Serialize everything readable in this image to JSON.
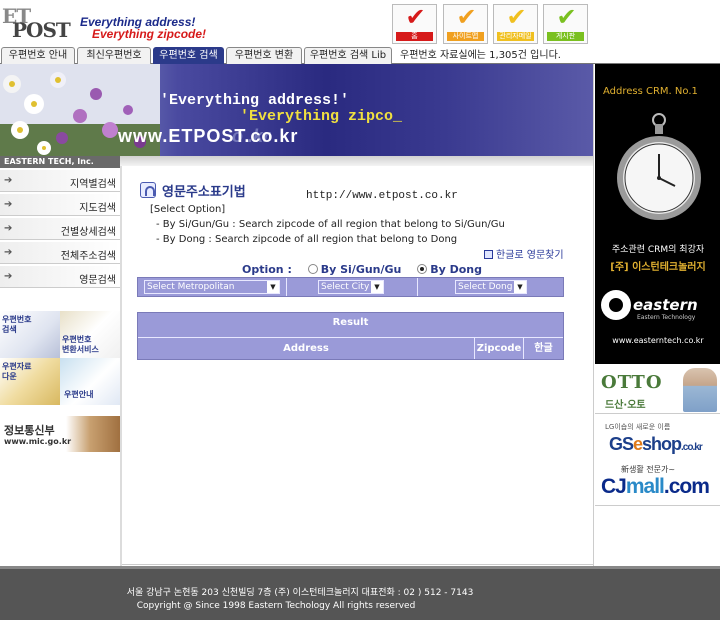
{
  "header": {
    "logo_et": "ET",
    "logo_post": "POST",
    "slogan_line1": "Everything address!",
    "slogan_line2": "Everything zipcode!",
    "checks": [
      {
        "label": "홈",
        "color": "#d61a1a",
        "mark": "✔"
      },
      {
        "label": "사이트맵",
        "color": "#f0a020",
        "mark": "✔"
      },
      {
        "label": "관리자메일",
        "color": "#f0c020",
        "mark": "✔"
      },
      {
        "label": "게시판",
        "color": "#7ac020",
        "mark": "✔"
      }
    ]
  },
  "nav": {
    "tabs": [
      "우편번호 안내",
      "최신우편번호",
      "우편번호 검색",
      "우편번호 변환",
      "우편번호 검색 Lib"
    ],
    "active_tab": "우편번호 검색",
    "info": "우편번호 자료실에는 1,305건 입니다."
  },
  "hero": {
    "line1": "'Everything address!'",
    "line2": "'Everything zipco_",
    "url": "www.ETPOST.co.kr",
    "url_shadow": "o .kr"
  },
  "sidebar": {
    "heading": "EASTERN TECH, Inc.",
    "items": [
      "지역별검색",
      "지도검색",
      "건별상세검색",
      "전체주소검색",
      "영문검색"
    ],
    "banners": {
      "a": "우편번호\n검색",
      "b": "우편번호\n변환서비스",
      "c": "우편자료\n다운",
      "d": "우편안내"
    },
    "mic_title": "정보통신부",
    "mic_url": "www.mic.go.kr"
  },
  "main": {
    "title": "영문주소표기법",
    "url": "http://www.etpost.co.kr",
    "select_option_title": "[Select Option]",
    "option_lines": [
      "- By Si/Gun/Gu : Search zipcode of all region that belong to Si/Gun/Gu",
      "- By Dong : Search zipcode of all region that belong to Dong"
    ],
    "korean_link": "한글로 영문찾기",
    "option_label": "Option :",
    "radio_a": "By Si/Gun/Gu",
    "radio_b": "By Dong",
    "selected_radio": "By Dong",
    "select_metro": "Select Metropolitan",
    "select_city": "Select City",
    "select_dong": "Select Dong",
    "result_head": "Result",
    "columns": [
      "Address",
      "Zipcode",
      "한글"
    ]
  },
  "right": {
    "crm_title": "Address CRM.  No.1",
    "crm_line1": "주소관련 CRM의 최강자",
    "crm_line2": "[주] 이스턴테크놀러지",
    "eastern_name": "eastern",
    "eastern_sub": "Eastern Technology",
    "eastern_url": "www.easterntech.co.kr",
    "otto_name": "OTTO",
    "otto_sub": "드산·오토",
    "gs_top": "LG이숍의 새로운 이름",
    "gs_main": "GS",
    "gs_e": "e",
    "gs_shop": "shop",
    "gs_domain": ".co.kr",
    "cj_top": "新생활 전문가~",
    "cj_cj": "CJ",
    "cj_mall": "mall",
    "cj_com": ".com"
  },
  "footer": {
    "line1": "서울 강남구 논현동 203 신천빌딩 7층    (주) 이스턴테크놀러지    대표전화 : 02 ) 512 - 7143",
    "line2": "Copyright @ Since 1998  Eastern Techology All rights reserved"
  }
}
